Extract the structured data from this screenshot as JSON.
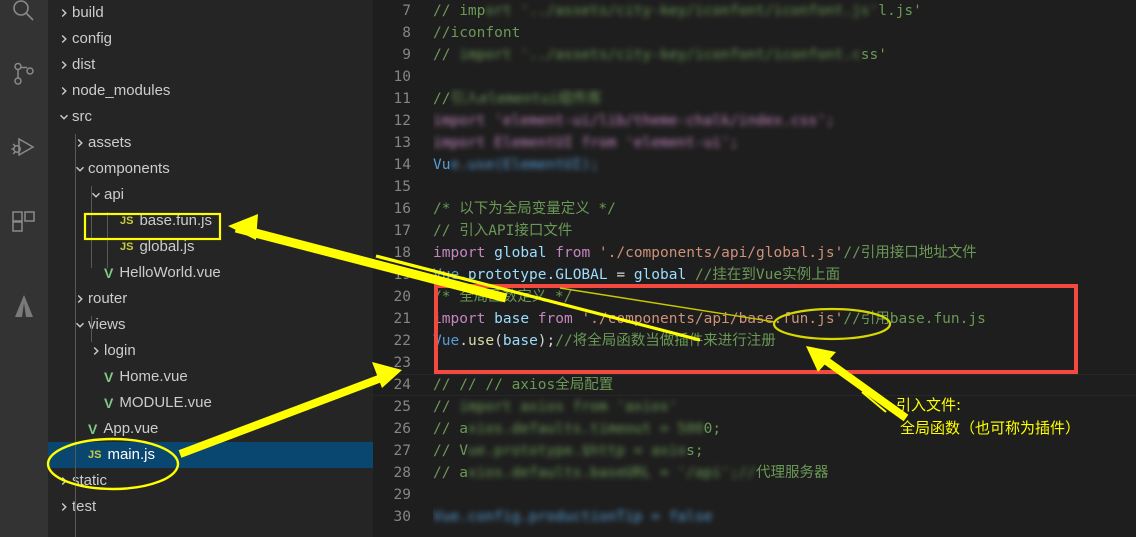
{
  "activity_bar": {
    "items": [
      {
        "name": "search-icon",
        "label": "Search"
      },
      {
        "name": "source-control-icon",
        "label": "Source Control"
      },
      {
        "name": "run-debug-icon",
        "label": "Run and Debug"
      },
      {
        "name": "extensions-icon",
        "label": "Extensions"
      },
      {
        "name": "app-logo-icon",
        "label": "Logo"
      }
    ]
  },
  "explorer": {
    "items": [
      {
        "label": "build",
        "indent": 1,
        "twisty": "right",
        "icon": "folder",
        "selected": false
      },
      {
        "label": "config",
        "indent": 1,
        "twisty": "right",
        "icon": "folder",
        "selected": false
      },
      {
        "label": "dist",
        "indent": 1,
        "twisty": "right",
        "icon": "folder",
        "selected": false
      },
      {
        "label": "node_modules",
        "indent": 1,
        "twisty": "right",
        "icon": "folder",
        "selected": false
      },
      {
        "label": "src",
        "indent": 1,
        "twisty": "down",
        "icon": "folder",
        "selected": false
      },
      {
        "label": "assets",
        "indent": 2,
        "twisty": "right",
        "icon": "folder",
        "selected": false
      },
      {
        "label": "components",
        "indent": 2,
        "twisty": "down",
        "icon": "folder",
        "selected": false
      },
      {
        "label": "api",
        "indent": 3,
        "twisty": "down",
        "icon": "folder",
        "selected": false
      },
      {
        "label": "base.fun.js",
        "indent": 4,
        "twisty": "none",
        "icon": "js",
        "selected": false,
        "icon_text": "JS"
      },
      {
        "label": "global.js",
        "indent": 4,
        "twisty": "none",
        "icon": "js",
        "selected": false,
        "icon_text": "JS"
      },
      {
        "label": "HelloWorld.vue",
        "indent": 3,
        "twisty": "none",
        "icon": "vue",
        "selected": false,
        "icon_text": "V"
      },
      {
        "label": "router",
        "indent": 2,
        "twisty": "right",
        "icon": "folder",
        "selected": false
      },
      {
        "label": "views",
        "indent": 2,
        "twisty": "down",
        "icon": "folder",
        "selected": false
      },
      {
        "label": "login",
        "indent": 3,
        "twisty": "right",
        "icon": "folder",
        "selected": false
      },
      {
        "label": "Home.vue",
        "indent": 3,
        "twisty": "none",
        "icon": "vue",
        "selected": false,
        "icon_text": "V"
      },
      {
        "label": "MODULE.vue",
        "indent": 3,
        "twisty": "none",
        "icon": "vue",
        "selected": false,
        "icon_text": "V"
      },
      {
        "label": "App.vue",
        "indent": 2,
        "twisty": "none",
        "icon": "vue",
        "selected": false,
        "icon_text": "V"
      },
      {
        "label": "main.js",
        "indent": 2,
        "twisty": "none",
        "icon": "js",
        "selected": true,
        "icon_text": "JS"
      },
      {
        "label": "static",
        "indent": 1,
        "twisty": "right",
        "icon": "folder",
        "selected": false
      },
      {
        "label": "test",
        "indent": 1,
        "twisty": "right",
        "icon": "folder",
        "selected": false
      }
    ],
    "selected_file": "main.js",
    "highlighted_file": "base.fun.js",
    "selection_color": "#094771",
    "highlight_box_color": "#ffff00"
  },
  "editor": {
    "first_visible_line": 7,
    "lines": [
      {
        "n": 7,
        "redacted": true,
        "tail": "l.js'",
        "prefix": "// imp",
        "text": "// import '../assets/city-key/iconfont/iconfont.js'"
      },
      {
        "n": 8,
        "redacted": false,
        "text": "//iconfont"
      },
      {
        "n": 9,
        "redacted": true,
        "prefix": "// ",
        "tail": "ss'",
        "text": "// import '../assets/city-key/iconfont/iconfont.css'"
      },
      {
        "n": 10,
        "redacted": false,
        "text": ""
      },
      {
        "n": 11,
        "redacted": true,
        "prefix": "//",
        "text": "//引入elementui组件库"
      },
      {
        "n": 12,
        "redacted": true,
        "text": "import 'element-ui/lib/theme-chalk/index.css';"
      },
      {
        "n": 13,
        "redacted": true,
        "text": "import ElementUI from 'element-ui';"
      },
      {
        "n": 14,
        "redacted": true,
        "prefix": "Vu",
        "text": "Vue.use(ElementUI);"
      },
      {
        "n": 15,
        "redacted": false,
        "text": ""
      },
      {
        "n": 16,
        "redacted": false,
        "text": "/* 以下为全局变量定义 */"
      },
      {
        "n": 17,
        "redacted": false,
        "text": "// 引入API接口文件"
      },
      {
        "n": 18,
        "redacted": false,
        "text": "import global from './components/api/global.js'//引用接口地址文件"
      },
      {
        "n": 19,
        "redacted": false,
        "text": "Vue.prototype.GLOBAL = global //挂在到Vue实例上面"
      },
      {
        "n": 20,
        "redacted": false,
        "text": "/* 全局函数定义 */"
      },
      {
        "n": 21,
        "redacted": false,
        "text": "import base from './components/api/base.fun.js'//引用base.fun.js"
      },
      {
        "n": 22,
        "redacted": false,
        "text": "Vue.use(base);//将全局函数当做插件来进行注册"
      },
      {
        "n": 23,
        "redacted": false,
        "text": ""
      },
      {
        "n": 24,
        "redacted": false,
        "text": "// // // axios全局配置"
      },
      {
        "n": 25,
        "redacted": true,
        "prefix": "// ",
        "text": "// import axios from 'axios'"
      },
      {
        "n": 26,
        "redacted": true,
        "prefix": "// a",
        "tail": "0;",
        "text": "// axios.defaults.timeout = 5000;"
      },
      {
        "n": 27,
        "redacted": true,
        "prefix": "// V",
        "tail": "s;",
        "text": "// Vue.prototype.$http = axios;"
      },
      {
        "n": 28,
        "redacted": true,
        "prefix": "// a",
        "tail": "代理服务器",
        "text": "// axios.defaults.baseURL = '/api';//代理服务器"
      },
      {
        "n": 29,
        "redacted": false,
        "text": ""
      },
      {
        "n": 30,
        "redacted": true,
        "text": "Vue.config.productionTip = false"
      }
    ]
  },
  "annotations": {
    "note_line1": "引入文件:",
    "note_line2": "全局函数（也可称为插件）",
    "note_color": "#ffff00",
    "red_box_color": "#f4493f",
    "red_box_covers_lines": [
      20,
      21,
      22
    ],
    "ellipse_code_target": "base.fun.js",
    "ellipse_tree_target": "main.js"
  }
}
